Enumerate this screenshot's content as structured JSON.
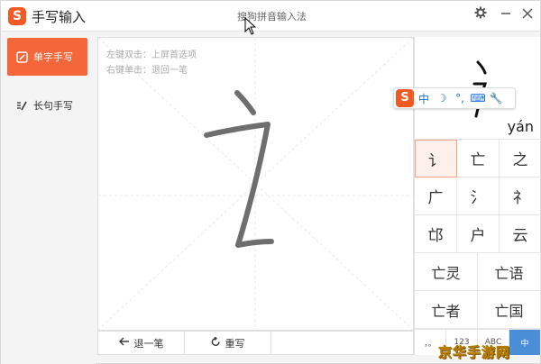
{
  "titlebar": {
    "logo_letter": "S",
    "title": "手写输入",
    "ime_name": "搜狗拼音输入法",
    "settings_icon": "gear-icon",
    "minimize_icon": "minimize-icon",
    "close_icon": "close-icon"
  },
  "sidebar": {
    "items": [
      {
        "label": "单字手写",
        "icon": "single-char-pen-icon",
        "active": true
      },
      {
        "label": "长句手写",
        "icon": "long-sentence-pen-icon",
        "active": false
      }
    ]
  },
  "canvas": {
    "hint_line1": "左键双击：上屏首选项",
    "hint_line2": "右键单击：退回一笔"
  },
  "buttons": {
    "undo_label": "退一笔",
    "redo_label": "重写"
  },
  "preview": {
    "pinyin": "yán"
  },
  "floating_toolbar": {
    "logo_letter": "S",
    "items": [
      "中",
      "☽",
      "°,",
      "⌨",
      "🔧"
    ]
  },
  "candidates": {
    "single_rows": [
      [
        "讠",
        "亡",
        "之"
      ],
      [
        "广",
        "氵",
        "礻"
      ],
      [
        "邙",
        "户",
        "云"
      ]
    ],
    "double_rows": [
      [
        "亡灵",
        "亡语"
      ],
      [
        "亡者",
        "亡国"
      ]
    ]
  },
  "keyrow": {
    "keys": [
      "，。",
      "123",
      "ABC",
      "中"
    ]
  },
  "watermark": "京华手游网",
  "colors": {
    "brand": "#f15a22",
    "accent": "#f5673a",
    "stroke": "#666666"
  }
}
